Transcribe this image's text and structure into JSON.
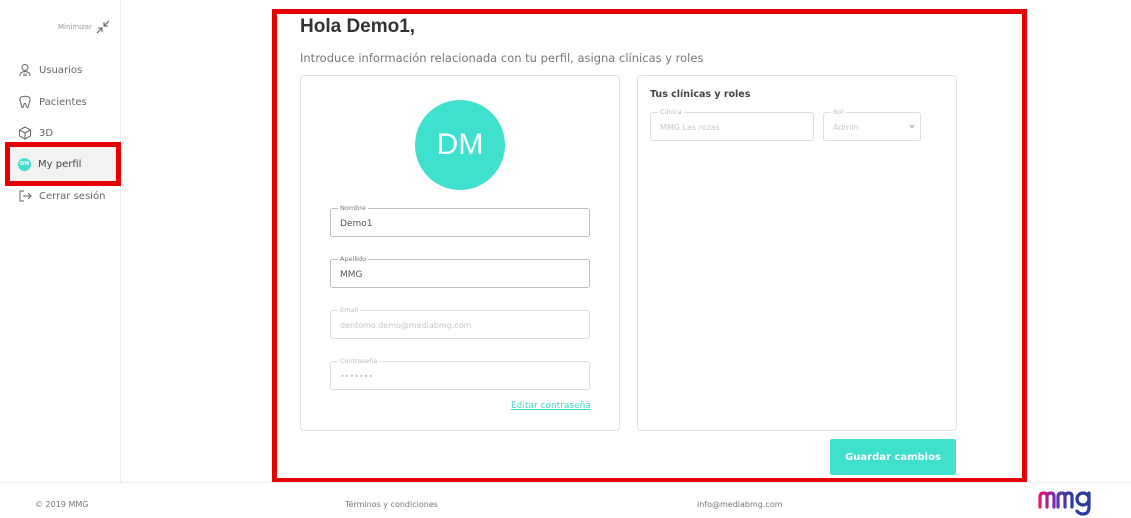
{
  "sidebar": {
    "minimize_label": "Minimizar",
    "items": [
      {
        "label": "Usuarios",
        "icon": "users-icon"
      },
      {
        "label": "Pacientes",
        "icon": "tooth-icon"
      },
      {
        "label": "3D",
        "icon": "cube-3d-icon"
      },
      {
        "label": "My perfil",
        "icon": "avatar-icon",
        "initials": "DM"
      },
      {
        "label": "Cerrar sesión",
        "icon": "logout-icon"
      }
    ],
    "active_item": "My perfil"
  },
  "main": {
    "greeting": "Hola Demo1,",
    "subtitle": "Introduce información relacionada con tu perfil, asigna clínicas y roles",
    "avatar_initials": "DM",
    "fields": {
      "nombre": {
        "label": "Nombre",
        "value": "Demo1"
      },
      "apellido": {
        "label": "Apellido",
        "value": "MMG"
      },
      "email": {
        "label": "Email",
        "value": "dentomo.demo@mediabmg.com"
      },
      "password": {
        "label": "Contraseña",
        "value": "•••••••"
      }
    },
    "edit_password_link": "Editar contraseña",
    "clinics": {
      "title": "Tus clínicas y roles",
      "clinic_label": "Clínica",
      "clinic_value": "MMG Las rozas",
      "rol_label": "Rol",
      "rol_value": "Admin"
    },
    "save_button": "Guardar cambios"
  },
  "footer": {
    "copyright": "© 2019 MMG",
    "terms": "Términos y condiciones",
    "email": "info@mediabmg.com",
    "logo_text": "mmg"
  },
  "colors": {
    "accent": "#40e0cf",
    "highlight": "#e60000",
    "logo_gradient": [
      "#e5186e",
      "#6a2fb8",
      "#2b3a9c"
    ]
  }
}
